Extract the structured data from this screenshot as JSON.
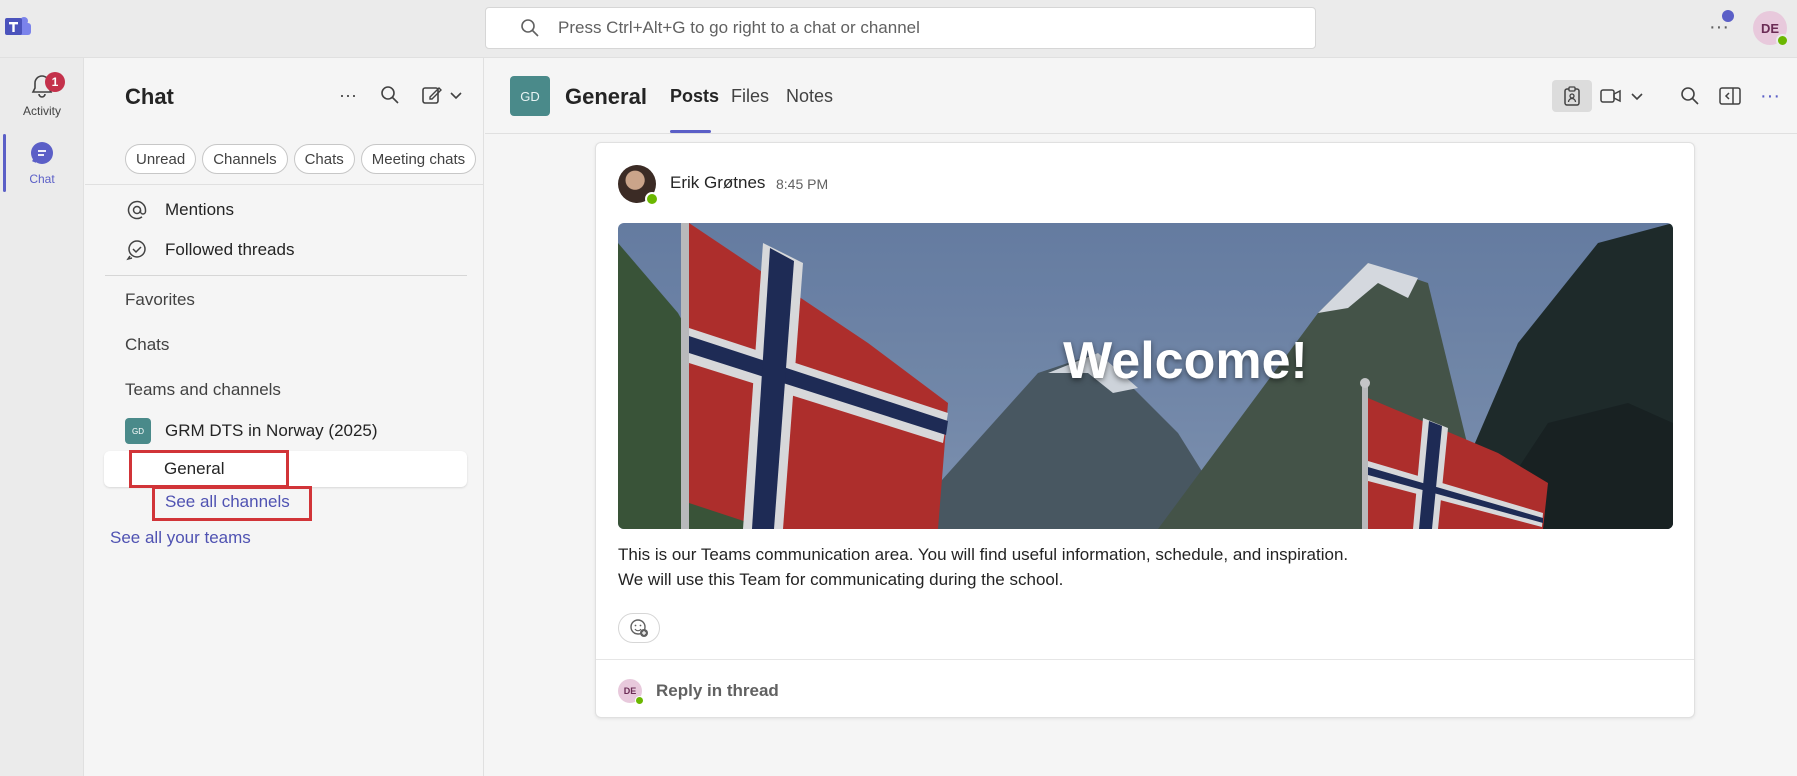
{
  "topbar": {
    "search_placeholder": "Press Ctrl+Alt+G to go right to a chat or channel",
    "avatar_initials": "DE"
  },
  "rail": {
    "activity_label": "Activity",
    "activity_badge": "1",
    "chat_label": "Chat"
  },
  "panel": {
    "title": "Chat",
    "filters": [
      "Unread",
      "Channels",
      "Chats",
      "Meeting chats"
    ],
    "mentions": "Mentions",
    "followed_threads": "Followed threads",
    "favorites": "Favorites",
    "chats": "Chats",
    "teams_and_channels": "Teams and channels",
    "team_avatar": "GD",
    "team_name": "GRM DTS in Norway (2025)",
    "channel_general": "General",
    "see_all_channels": "See all channels",
    "see_all_teams": "See all your teams"
  },
  "header": {
    "channel_avatar": "GD",
    "channel_title": "General",
    "tabs": [
      "Posts",
      "Files",
      "Notes"
    ],
    "active_tab": "Posts"
  },
  "post": {
    "author": "Erik Grøtnes",
    "time": "8:45 PM",
    "banner_text": "Welcome!",
    "body_line1": "This is our Teams communication area. You will find useful information, schedule, and inspiration.",
    "body_line2": "We will use this Team for communicating during the school.",
    "reply_avatar": "DE",
    "reply_label": "Reply in thread"
  },
  "colors": {
    "accent": "#5b5fc7",
    "link": "#4f52b2",
    "highlight_box": "#d13438",
    "presence_available": "#6bb700",
    "badge": "#c4314b"
  }
}
